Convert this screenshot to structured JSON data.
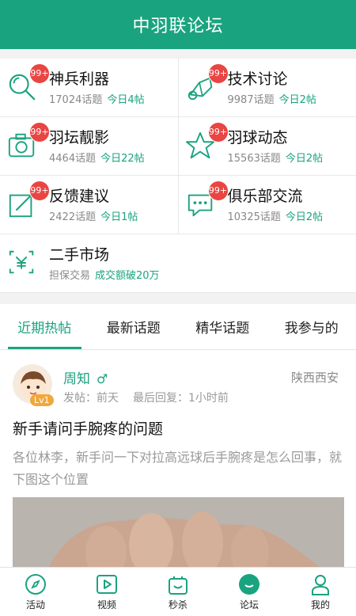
{
  "header": {
    "title": "中羽联论坛"
  },
  "forums": [
    {
      "name": "神兵利器",
      "topics": "17024话题",
      "today": "今日4帖",
      "badge": "99+",
      "icon": "search-icon"
    },
    {
      "name": "技术讨论",
      "topics": "9987话题",
      "today": "今日2帖",
      "badge": "99+",
      "icon": "shuttlecock-icon"
    },
    {
      "name": "羽坛靓影",
      "topics": "4464话题",
      "today": "今日22帖",
      "badge": "99+",
      "icon": "camera-icon"
    },
    {
      "name": "羽球动态",
      "topics": "15563话题",
      "today": "今日2帖",
      "badge": "99+",
      "icon": "star-icon"
    },
    {
      "name": "反馈建议",
      "topics": "2422话题",
      "today": "今日1帖",
      "badge": "99+",
      "icon": "edit-icon"
    },
    {
      "name": "俱乐部交流",
      "topics": "10325话题",
      "today": "今日2帖",
      "badge": "99+",
      "icon": "chat-icon"
    },
    {
      "name": "二手市场",
      "topics": "担保交易",
      "today": "成交额破20万",
      "icon": "yen-icon"
    }
  ],
  "tabs": [
    {
      "label": "近期热帖",
      "active": true
    },
    {
      "label": "最新话题",
      "active": false
    },
    {
      "label": "精华话题",
      "active": false
    },
    {
      "label": "我参与的",
      "active": false
    }
  ],
  "post": {
    "author": "周知",
    "gender_symbol": "♂",
    "level": "Lv1",
    "location": "陕西西安",
    "posted": "发帖：前天",
    "last_reply": "最后回复：1小时前",
    "title": "新手请问手腕疼的问题",
    "body": "各位林李，新手问一下对拉高远球后手腕疼是怎么回事，就下图这个位置"
  },
  "bottom_nav": [
    {
      "label": "活动",
      "icon": "compass-icon"
    },
    {
      "label": "视频",
      "icon": "play-icon"
    },
    {
      "label": "秒杀",
      "icon": "bag-icon"
    },
    {
      "label": "论坛",
      "icon": "forum-bubble-icon",
      "active": true
    },
    {
      "label": "我的",
      "icon": "user-icon"
    }
  ],
  "colors": {
    "primary": "#1aa37f",
    "badge": "#e94542",
    "level": "#f0a83a"
  }
}
